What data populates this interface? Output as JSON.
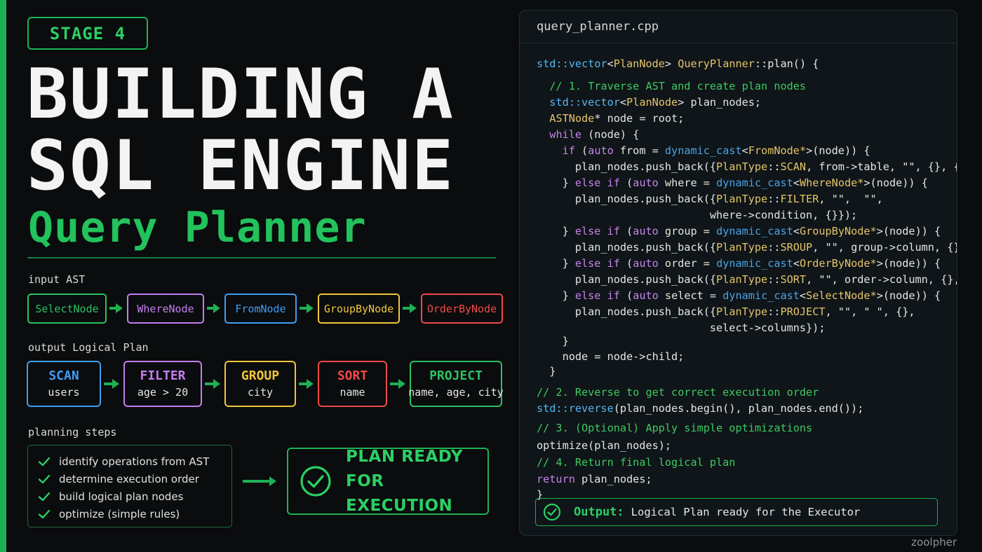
{
  "stage": "STAGE 4",
  "title_line1": "BUILDING A",
  "title_line2": "SQL ENGINE",
  "subtitle": "Query Planner",
  "input_ast": {
    "label": "input AST",
    "nodes": [
      {
        "label": "SelectNode",
        "color": "#2ec162"
      },
      {
        "label": "WhereNode",
        "color": "#c47ef0"
      },
      {
        "label": "FromNode",
        "color": "#3f9ef5"
      },
      {
        "label": "GroupByNode",
        "color": "#f0c63a"
      },
      {
        "label": "OrderByNode",
        "color": "#f04848"
      }
    ]
  },
  "logical_plan": {
    "label": "output Logical Plan",
    "nodes": [
      {
        "op": "SCAN",
        "arg": "users",
        "color": "#3f9ef5"
      },
      {
        "op": "FILTER",
        "arg": "age > 20",
        "color": "#c47ef0"
      },
      {
        "op": "GROUP",
        "arg": "city",
        "color": "#f0c63a"
      },
      {
        "op": "SORT",
        "arg": "name",
        "color": "#f04848"
      },
      {
        "op": "PROJECT",
        "arg": "name, age, city",
        "color": "#2ec162"
      }
    ]
  },
  "planning_steps": {
    "label": "planning steps",
    "items": [
      "identify operations from AST",
      "determine execution order",
      "build logical plan nodes",
      "optimize (simple rules)"
    ]
  },
  "ready": {
    "line1": "PLAN READY FOR",
    "line2": "EXECUTION"
  },
  "code": {
    "filename": "query_planner.cpp",
    "lines": [
      "std::vector<PlanNode> QueryPlanner::plan() {",
      "  // 1. Traverse AST and create plan nodes",
      "  std::vector<PlanNode> plan_nodes;",
      "  ASTNode* node = root;",
      "  while (node) {",
      "    if (auto from = dynamic_cast<FromNode*>(node)) {",
      "      plan_nodes.push_back({PlanType::SCAN, from->table, \"\", {}, {}});",
      "    } else if (auto where = dynamic_cast<WhereNode*>(node)) {",
      "      plan_nodes.push_back({PlanType::FILTER, \"\",  \"\",",
      "                           where->condition, {}});",
      "    } else if (auto group = dynamic_cast<GroupByNode*>(node)) {",
      "      plan_nodes.push_back({PlanType::SROUP, \"\", group->column, {}, {}});",
      "    } else if (auto order = dynamic_cast<OrderByNode*>(node)) {",
      "      plan_nodes.push_back({PlanType::SORT, \"\", order->column, {}, {}});",
      "    } else if (auto select = dynamic_cast<SelectNode*>(node)) {",
      "      plan_nodes.push_back({PlanType::PROJECT, \"\", \" \", {},",
      "                           select->columns});",
      "    }",
      "    node = node->child;",
      "  }",
      "// 2. Reverse to get correct execution order",
      "std::reverse(plan_nodes.begin(), plan_nodes.end());",
      "// 3. (Optional) Apply simple optimizations",
      "optimize(plan_nodes);",
      "// 4. Return final logical plan",
      "return plan_nodes;",
      "}"
    ]
  },
  "output": {
    "label": "Output:",
    "text": "Logical Plan ready for the Executor"
  },
  "watermark": "zoolpher"
}
